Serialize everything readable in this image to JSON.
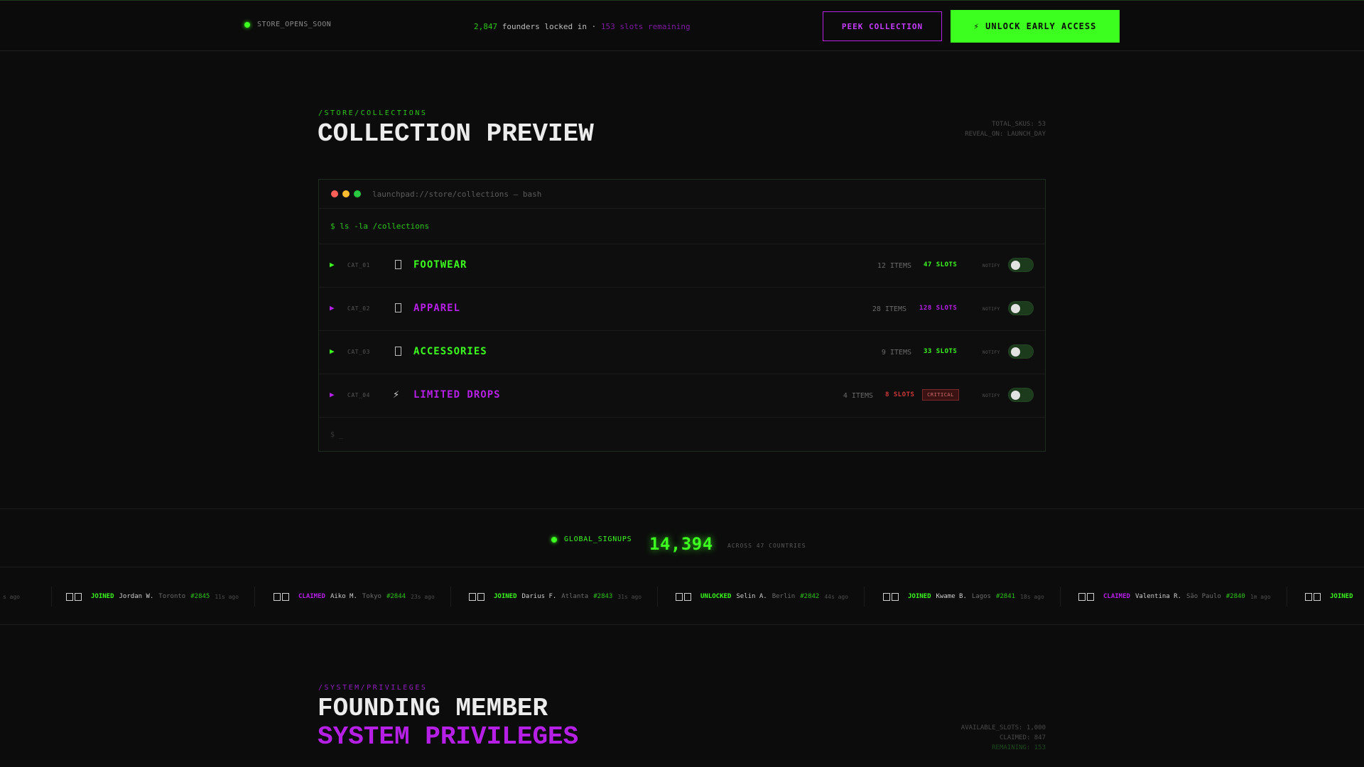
{
  "topbar": {
    "status": "STORE_OPENS_SOON",
    "founders_count": "2,847",
    "founders_text": " founders locked in · ",
    "slots_remaining": "153 slots remaining",
    "peek_label": "PEEK COLLECTION",
    "unlock_label": "⚡ UNLOCK EARLY ACCESS"
  },
  "collections": {
    "eyebrow": "/STORE/COLLECTIONS",
    "title": "COLLECTION PREVIEW",
    "meta": [
      "TOTAL_SKUS: 53",
      "REVEAL_ON: LAUNCH_DAY"
    ],
    "terminal_title": "launchpad://store/collections — bash",
    "command": "$ ls -la /collections",
    "prompt": "$ _",
    "rows": [
      {
        "cat": "CAT_01",
        "name": "FOOTWEAR",
        "items": "12 ITEMS",
        "slots": "47 SLOTS",
        "notify": "NOTIFY",
        "icon": "box-icon",
        "color": "#3cff1f"
      },
      {
        "cat": "CAT_02",
        "name": "APPAREL",
        "items": "28 ITEMS",
        "slots": "128 SLOTS",
        "notify": "NOTIFY",
        "icon": "box-icon",
        "color": "#b51fe6"
      },
      {
        "cat": "CAT_03",
        "name": "ACCESSORIES",
        "items": "9 ITEMS",
        "slots": "33 SLOTS",
        "notify": "NOTIFY",
        "icon": "box-icon",
        "color": "#3cff1f"
      },
      {
        "cat": "CAT_04",
        "name": "LIMITED DROPS",
        "items": "4 ITEMS",
        "slots": "8 SLOTS",
        "badge": "CRITICAL",
        "notify": "NOTIFY",
        "icon": "bolt-icon",
        "color": "#b51fe6"
      }
    ]
  },
  "signups": {
    "label": "GLOBAL_SIGNUPS",
    "count": "14,394",
    "across": "ACROSS 47 COUNTRIES"
  },
  "ticker": [
    {
      "action": "JOINED",
      "name": "Jordan W.",
      "city": "Toronto",
      "num": "#2845",
      "ago": "11s ago",
      "color": "#3cff1f"
    },
    {
      "action": "CLAIMED",
      "name": "Aiko M.",
      "city": "Tokyo",
      "num": "#2844",
      "ago": "23s ago",
      "color": "#b51fe6"
    },
    {
      "action": "JOINED",
      "name": "Darius F.",
      "city": "Atlanta",
      "num": "#2843",
      "ago": "31s ago",
      "color": "#3cff1f"
    },
    {
      "action": "UNLOCKED",
      "name": "Selin A.",
      "city": "Berlin",
      "num": "#2842",
      "ago": "44s ago",
      "color": "#3cff1f"
    },
    {
      "action": "JOINED",
      "name": "Kwame B.",
      "city": "Lagos",
      "num": "#2841",
      "ago": "18s ago",
      "color": "#3cff1f"
    },
    {
      "action": "CLAIMED",
      "name": "Valentina R.",
      "city": "São Paulo",
      "num": "#2840",
      "ago": "1m ago",
      "color": "#b51fe6"
    },
    {
      "action": "JOINED",
      "name": "",
      "city": "",
      "num": "",
      "ago": "",
      "color": "#3cff1f"
    }
  ],
  "ticker_fragment": "s ago",
  "privileges": {
    "eyebrow": "/SYSTEM/PRIVILEGES",
    "title1": "FOUNDING MEMBER",
    "title2": "SYSTEM PRIVILEGES",
    "meta": [
      "AVAILABLE_SLOTS: 1,000",
      "CLAIMED: 847",
      "REMAINING: 153"
    ]
  },
  "colors": {
    "accent_green": "#3cff1f",
    "accent_purple": "#b51fe6",
    "critical": "#d03838",
    "bg": "#0c0c0c"
  }
}
